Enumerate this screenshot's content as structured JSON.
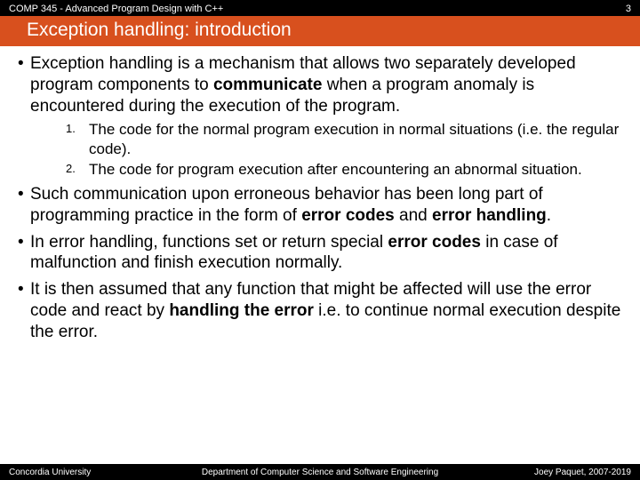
{
  "header": {
    "course": "COMP 345 - Advanced Program Design with C++",
    "page_number": "3"
  },
  "title": "Exception handling: introduction",
  "bullets": {
    "b1_a": "Exception handling is a mechanism that allows two separately developed program components to ",
    "b1_strong": "communicate",
    "b1_b": " when a program anomaly is encountered during the execution of the program.",
    "sub1": "The code for the normal program execution in normal situations (i.e. the regular code).",
    "sub2": "The code for program execution after encountering an abnormal situation.",
    "b2_a": "Such communication upon erroneous behavior has been long part of programming practice in the form of ",
    "b2_s1": "error codes",
    "b2_mid": " and ",
    "b2_s2": "error handling",
    "b2_end": ".",
    "b3_a": "In error handling, functions set or return special ",
    "b3_s1": "error codes",
    "b3_b": " in case of malfunction and finish execution normally.",
    "b4_a": "It is then assumed that any function that might be affected will use the error code and react by ",
    "b4_s1": "handling the error",
    "b4_b": " i.e. to continue normal execution despite the error."
  },
  "footer": {
    "left": "Concordia University",
    "center": "Department of Computer Science and Software Engineering",
    "right": "Joey Paquet, 2007-2019"
  }
}
